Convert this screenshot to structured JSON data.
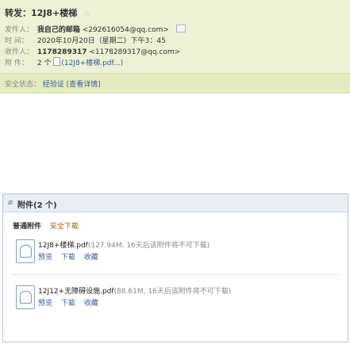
{
  "mail": {
    "subject": "转发：12J8+楼梯",
    "sender_label": "发件人：",
    "sender_name": "我自己的邮箱",
    "sender_email": "<292616054@qq.com>",
    "time_label": "时  间：",
    "time_value": "2020年10月20日（星期二）下午3：45",
    "recipient_label": "收件人：",
    "recipient_name": "1178289317",
    "recipient_email": "<1178289317@qq.com>",
    "attachment_label": "附  件：",
    "attachment_count": "2 个",
    "attachment_preview": "(12J8+楼梯.pdf...)"
  },
  "security_bar": {
    "label": "安全状态：",
    "status": "经验证 [查看详情]"
  },
  "attachments": {
    "header": "附件(2 个)",
    "group_label": "普通附件",
    "tip": "安全下载",
    "items": [
      {
        "name": "12J8+楼梯.pdf",
        "meta": "(127.94M, 16天后该附件将不可下载)",
        "actions": [
          "预览",
          "下载",
          "收藏"
        ]
      },
      {
        "name": "12J12+无障碍设施.pdf",
        "meta": "(88.61M, 16天后该附件将不可下载)",
        "actions": [
          "预览",
          "下载",
          "收藏"
        ]
      }
    ]
  }
}
